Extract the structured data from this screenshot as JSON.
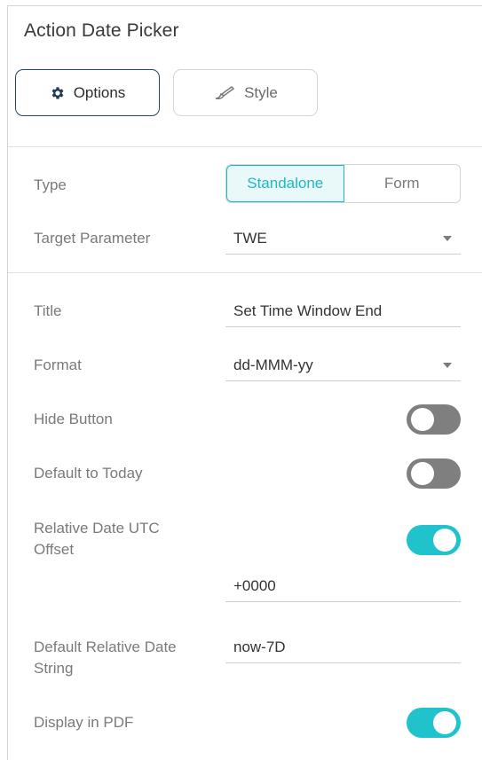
{
  "panel": {
    "title": "Action Date Picker"
  },
  "tabs": {
    "options": "Options",
    "style": "Style"
  },
  "type_row": {
    "label": "Type",
    "options": [
      "Standalone",
      "Form"
    ],
    "selected": "Standalone"
  },
  "target_parameter": {
    "label": "Target Parameter",
    "value": "TWE"
  },
  "title_row": {
    "label": "Title",
    "value": "Set Time Window End"
  },
  "format_row": {
    "label": "Format",
    "value": "dd-MMM-yy"
  },
  "hide_button": {
    "label": "Hide Button",
    "enabled": false
  },
  "default_today": {
    "label": "Default to Today",
    "enabled": false
  },
  "relative_utc": {
    "label_line1": "Relative Date UTC",
    "label_line2": "Offset",
    "enabled": true,
    "value": "+0000"
  },
  "default_relative": {
    "label_line1": "Default Relative Date",
    "label_line2": "String",
    "value": "now-7D"
  },
  "display_pdf": {
    "label": "Display in PDF",
    "enabled": true
  },
  "colors": {
    "accent": "#20c3cb",
    "toggle_off": "#7f7f7f",
    "options_border": "#1f4b63"
  },
  "icons": {
    "options": "gear-icon",
    "style": "brush-icon",
    "dropdown": "chevron-down-icon"
  }
}
